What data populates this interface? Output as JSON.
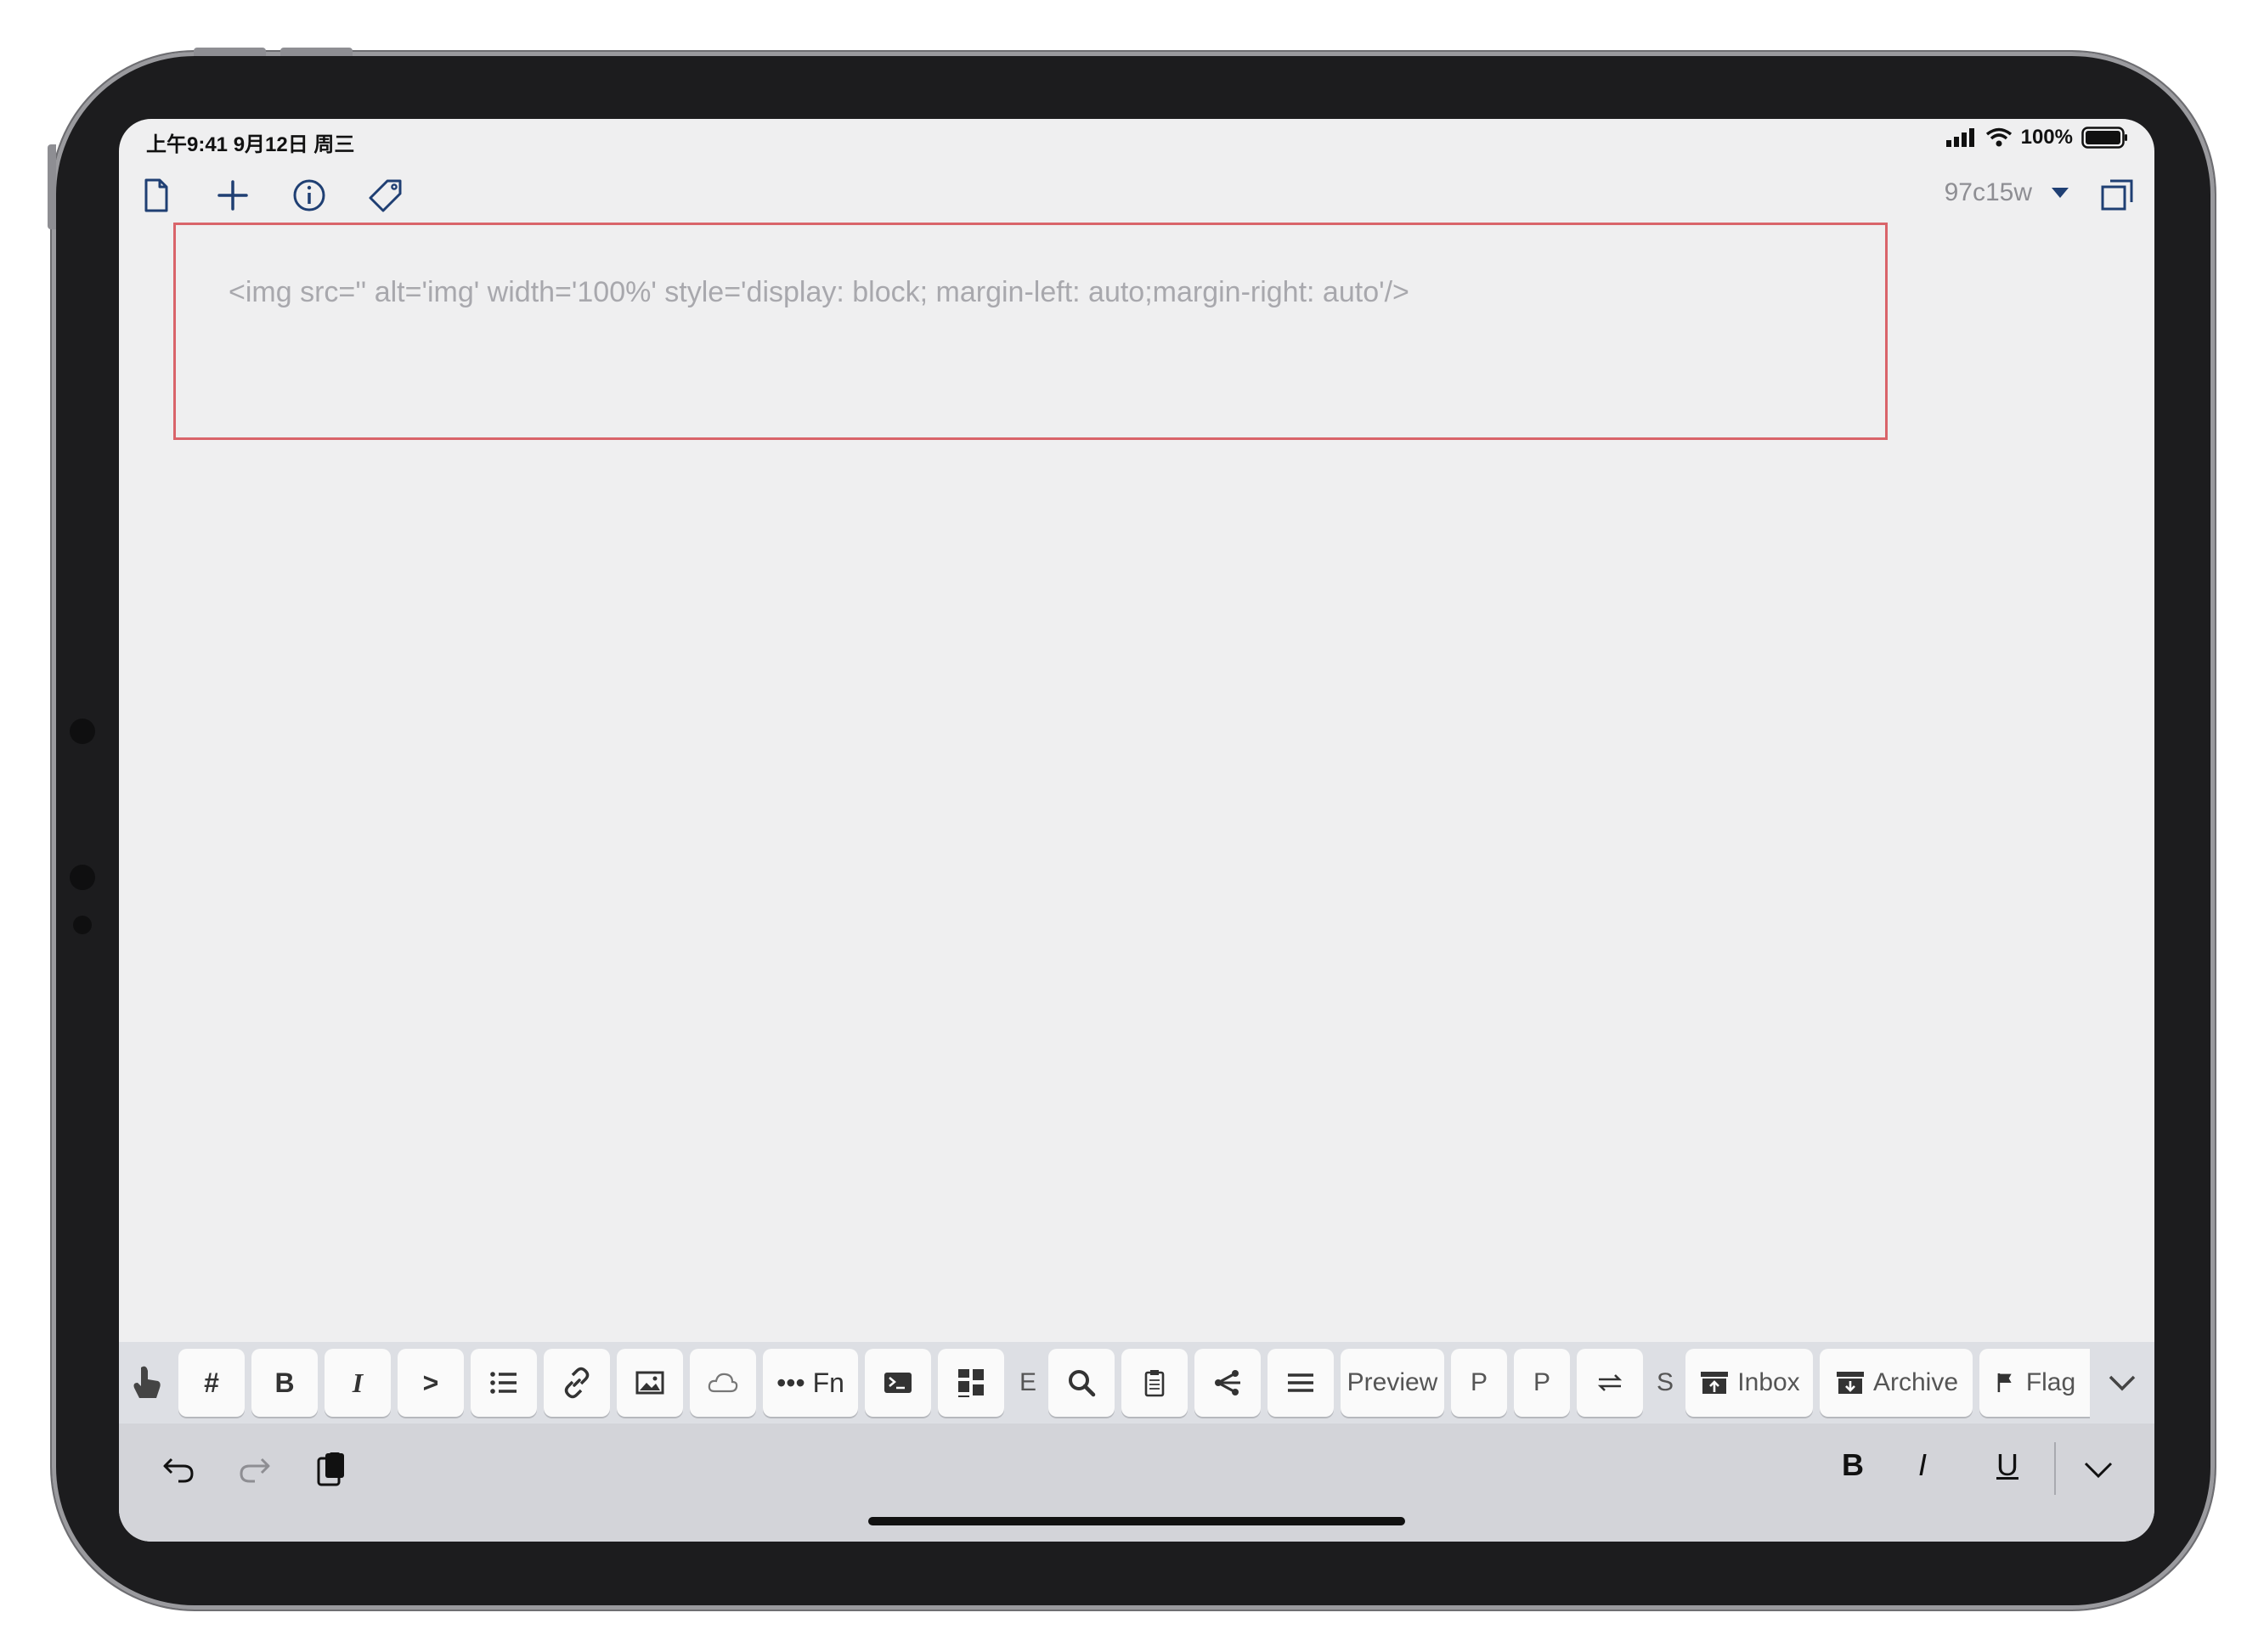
{
  "status_bar": {
    "time_date": "上午9:41  9月12日 周三",
    "battery": "100%"
  },
  "toolbar": {
    "document_name": "97c15w",
    "icons": [
      "document-icon",
      "plus-icon",
      "info-icon",
      "tag-icon",
      "caret-down-icon",
      "expand-window-icon"
    ]
  },
  "editor": {
    "placeholder": "<img src='' alt='img' width='100%' style='display: block; margin-left: auto;margin-right: auto'/>"
  },
  "keyboard_toolbar": {
    "keys": {
      "hash": "#",
      "bold": "B",
      "italic": "I",
      "quote": ">",
      "fn": "••• Fn",
      "e": "E",
      "preview": "Preview",
      "p1": "P",
      "p2": "P",
      "s": "S",
      "inbox": "Inbox",
      "archive": "Archive",
      "flag": "Flag"
    }
  },
  "keyboard_shortcuts": {
    "bold": "B",
    "italic": "I",
    "underline": "U"
  },
  "colors": {
    "accent": "#1f3f73",
    "editor_border": "#d9646a",
    "placeholder": "#a8a8ad",
    "screen_bg": "#efeff0"
  }
}
